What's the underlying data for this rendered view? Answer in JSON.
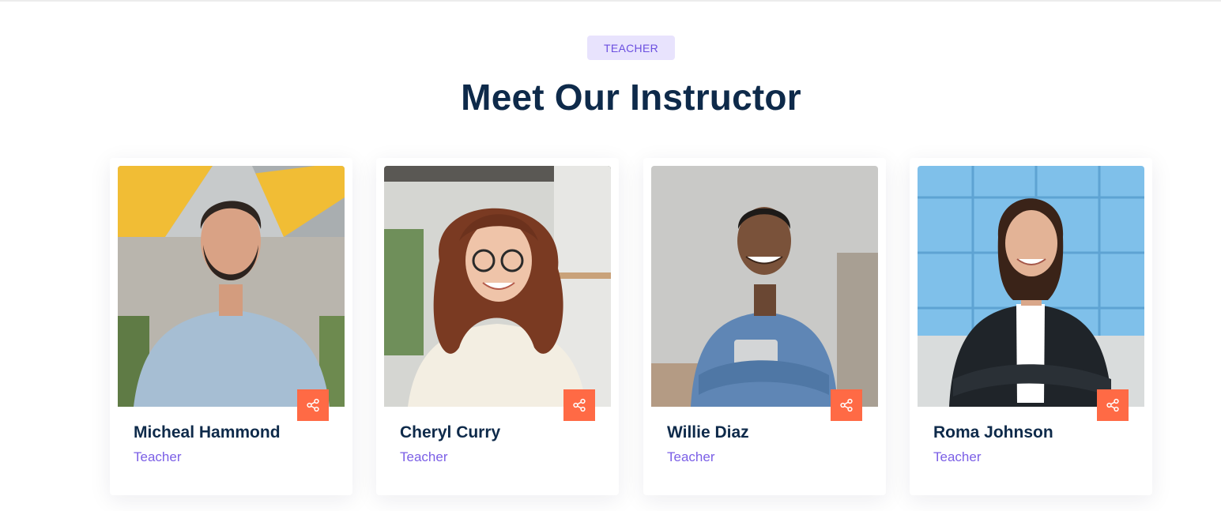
{
  "section": {
    "badge": "TEACHER",
    "title": "Meet Our Instructor"
  },
  "instructors": [
    {
      "name": "Micheal Hammond",
      "role": "Teacher",
      "share_icon": "share-icon"
    },
    {
      "name": "Cheryl Curry",
      "role": "Teacher",
      "share_icon": "share-icon"
    },
    {
      "name": "Willie Diaz",
      "role": "Teacher",
      "share_icon": "share-icon"
    },
    {
      "name": "Roma Johnson",
      "role": "Teacher",
      "share_icon": "share-icon"
    }
  ],
  "colors": {
    "accent": "#ff6a45",
    "heading": "#0e2a4a",
    "role_text": "#7b5fe6",
    "badge_bg": "#e8e3fd"
  }
}
